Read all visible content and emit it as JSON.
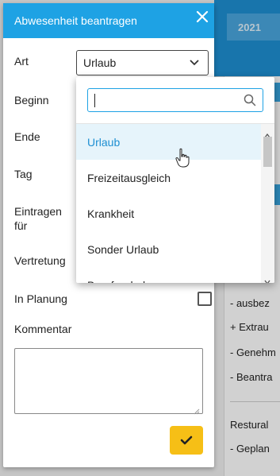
{
  "background": {
    "year_tab": "2021",
    "lines": [
      "- ausbez",
      "+ Extrau",
      "- Genehm",
      "- Beantra",
      "Restural",
      "- Geplan"
    ]
  },
  "dialog": {
    "title": "Abwesenheit beantragen",
    "close_icon": "close-icon",
    "fields": {
      "art_label": "Art",
      "art_value": "Urlaub",
      "beginn_label": "Beginn",
      "ende_label": "Ende",
      "tag_label": "Tag",
      "eintragen_label_line1": "Eintragen",
      "eintragen_label_line2": "für",
      "vertretung_label": "Vertretung",
      "in_planung_label": "In Planung",
      "kommentar_label": "Kommentar"
    },
    "confirm_icon": "check-icon"
  },
  "dropdown": {
    "search_value": "",
    "items": [
      "Urlaub",
      "Freizeitausgleich",
      "Krankheit",
      "Sonder Urlaub",
      "Berufsschule"
    ],
    "active_index": 0
  },
  "colors": {
    "header_blue": "#1ea2e4",
    "confirm_yellow": "#f6bf16",
    "active_item_bg": "#e6f4fb",
    "active_item_text": "#1e8fd2"
  }
}
